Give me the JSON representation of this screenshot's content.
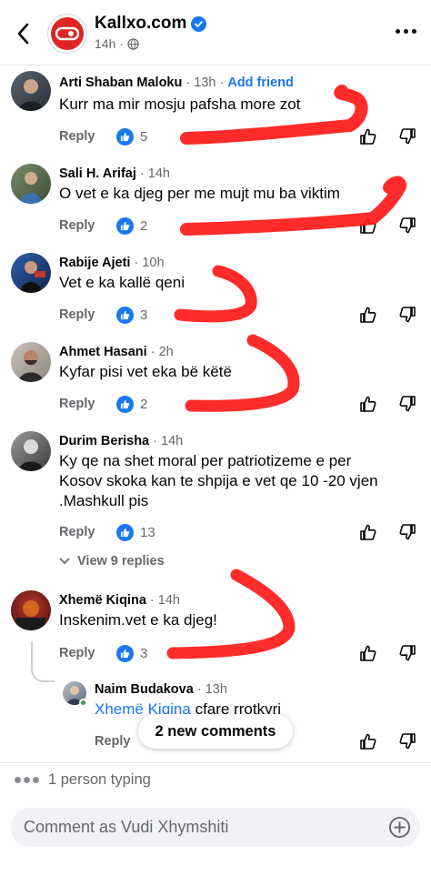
{
  "header": {
    "page_name": "Kallxo.com",
    "time": "14h"
  },
  "comments": [
    {
      "author": "Arti Shaban Maloku",
      "time": "13h",
      "add_friend": "Add friend",
      "text": "Kurr ma mir mosju pafsha more zot",
      "reply_label": "Reply",
      "likes": "5"
    },
    {
      "author": "Sali H. Arifaj",
      "time": "14h",
      "text": "O vet e ka djeg per me mujt mu ba viktim",
      "reply_label": "Reply",
      "likes": "2"
    },
    {
      "author": "Rabije Ajeti",
      "time": "10h",
      "text": "Vet e ka kallë qeni",
      "reply_label": "Reply",
      "likes": "3"
    },
    {
      "author": "Ahmet Hasani",
      "time": "2h",
      "text": "Kyfar pisi vet eka bë këtë",
      "reply_label": "Reply",
      "likes": "2"
    },
    {
      "author": "Durim Berisha",
      "time": "14h",
      "text": "Ky qe na shet moral per patriotizeme e per Kosov skoka kan te shpija e vet qe 10 -20 vjen .Mashkull pis",
      "reply_label": "Reply",
      "likes": "13",
      "view_replies": "View 9 replies"
    },
    {
      "author": "Xhemë Kiqina",
      "time": "14h",
      "text": "Inskenim.vet e ka djeg!",
      "reply_label": "Reply",
      "likes": "3"
    }
  ],
  "nested_reply": {
    "author": "Naim Budakova",
    "time": "13h",
    "mention": "Xhemë Kiqina",
    "text": "cfare rrotkyri",
    "reply_label": "Reply"
  },
  "new_comments_label": "2 new comments",
  "typing_text": "1 person typing",
  "comment_input": {
    "placeholder": "Comment as Vudi Xhymshiti"
  },
  "colors": {
    "accent": "#1877f2",
    "brand_red": "#e02424",
    "scribble_red": "#ff1a1a",
    "secondary_text": "#65676b"
  }
}
